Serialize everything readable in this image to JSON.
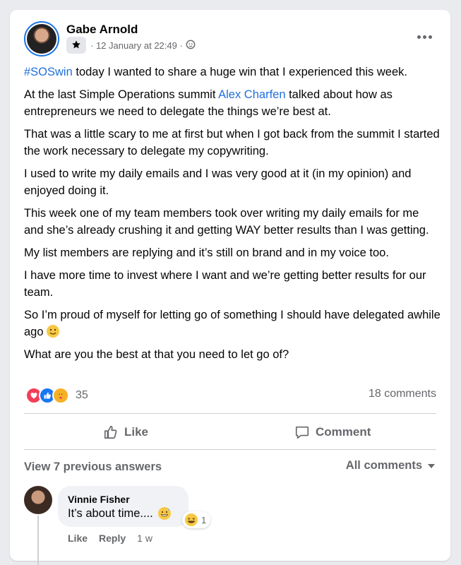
{
  "post": {
    "author": "Gabe Arnold",
    "timestamp": "· 12 January at 22:49 ·",
    "audience_icon": "globe-icon",
    "badge_icon": "star-badge-icon",
    "hashtag": "#SOSwin",
    "para1_rest": " today I wanted to share a huge win that I experienced this week.",
    "para2_before": "At the last Simple Operations summit ",
    "para2_link": "Alex Charfen",
    "para2_after": " talked about how as entrepreneurs we need to delegate the things we’re best at.",
    "para3": "That was a little scary to me at first but when I got back from the summit I started the work necessary to delegate my copywriting.",
    "para4": "I used to write my daily emails and I was very good at it (in my opinion) and enjoyed doing it.",
    "para5": "This week one of my team members took over writing my daily emails for me and she’s already crushing it and getting WAY better results than I was getting.",
    "para6": "My list members are replying and it’s still on brand and in my voice too.",
    "para7": "I have more time to invest where I want and we’re getting better results for our team.",
    "para8": "So I’m proud of myself for letting go of something I should have delegated awhile  ago ",
    "para9": "What are you the best at that you need to let go of?"
  },
  "stats": {
    "reaction_count": "35",
    "comments": "18 comments",
    "reaction_icons": [
      "love-icon",
      "like-icon",
      "care-icon"
    ]
  },
  "actions": {
    "like": "Like",
    "comment": "Comment"
  },
  "comments_section": {
    "view_previous": "View 7 previous answers",
    "filter": "All comments"
  },
  "comment": {
    "author": "Vinnie Fisher",
    "text": "It’s about time....",
    "reaction_count": "1",
    "like": "Like",
    "reply": "Reply",
    "age": "1 w"
  },
  "colors": {
    "link": "#216fdb",
    "muted": "#65676b",
    "accent": "#1b74e4"
  }
}
